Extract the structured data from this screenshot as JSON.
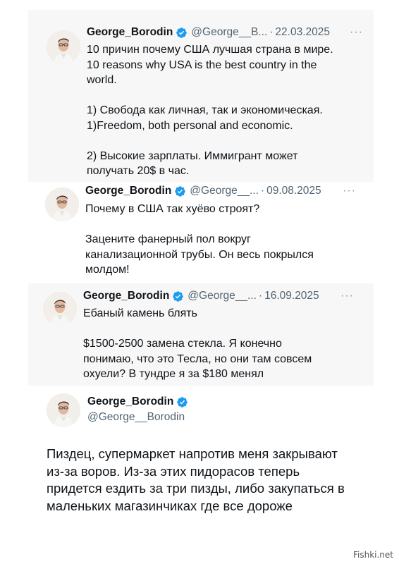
{
  "tweets": [
    {
      "display_name": "George_Borodin",
      "handle": "@George__B...",
      "date": "22.03.2025",
      "lines": [
        "10 причин почему США лучшая страна в мире.",
        "10 reasons why USA is the best country in the",
        "world.",
        "",
        "1) Свобода как личная, так и экономическая.",
        "1)Freedom, both personal and economic.",
        "",
        "2) Высокие зарплаты. Иммигрант может",
        "получать 20$ в час."
      ]
    },
    {
      "display_name": "George_Borodin",
      "handle": "@George__...",
      "date": "09.08.2025",
      "lines": [
        "Почему в США так хуёво строят?",
        "",
        "Зацените фанерный пол вокруг",
        "канализационной трубы. Он весь покрылся",
        "молдом!"
      ]
    },
    {
      "display_name": "George_Borodin",
      "handle": "@George__...",
      "date": "16.09.2025",
      "lines": [
        "Ебаный камень блять",
        "",
        "$1500-2500 замена стекла. Я конечно",
        "понимаю, что это Тесла, но они там совсем",
        "охуели? В тундре я за $180 менял"
      ]
    }
  ],
  "main_tweet": {
    "display_name": "George_Borodin",
    "handle": "@George__Borodin",
    "lines": [
      "Пиздец, супермаркет напротив меня закрывают",
      "из-за воров. Из-за этих пидорасов теперь",
      "придется ездить за три пизды, либо закупаться в",
      "маленьких магазинчиках где все дороже"
    ]
  },
  "separator": "·",
  "more_glyph": "···",
  "watermark": "Fishki.net",
  "icons": {
    "verified": "verified-badge-icon",
    "more": "more-options-icon"
  },
  "colors": {
    "verified": "#1d9bf0",
    "meta": "#536471",
    "text": "#0f1419"
  }
}
